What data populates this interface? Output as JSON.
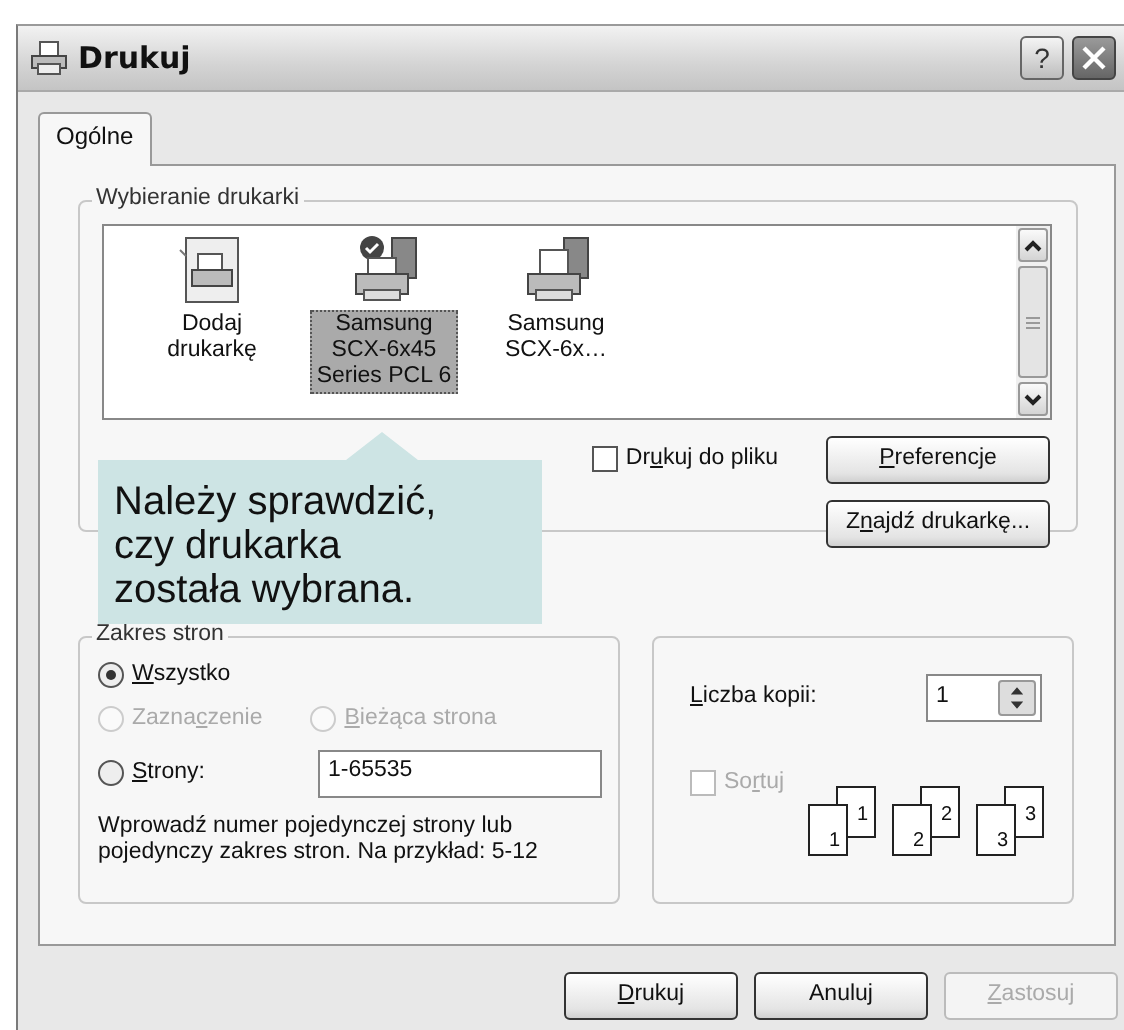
{
  "window": {
    "title": "Drukuj",
    "help": "?"
  },
  "tabs": [
    {
      "label": "Ogólne",
      "selected": true
    }
  ],
  "printer_selection": {
    "title": "Wybieranie drukarki",
    "printers": [
      {
        "lines": [
          "Dodaj",
          "drukarkę"
        ],
        "kind": "add",
        "selected": false
      },
      {
        "lines": [
          "Samsung",
          "SCX-6x45",
          "Series PCL 6"
        ],
        "kind": "default",
        "selected": true
      },
      {
        "lines": [
          "Samsung",
          "SCX-6x…"
        ],
        "kind": "printer",
        "selected": false
      }
    ],
    "print_to_file": {
      "label": [
        {
          "text": "Dr",
          "underline": false
        },
        {
          "text": "u",
          "underline": true
        },
        {
          "text": "kuj do pliku",
          "underline": false
        }
      ],
      "checked": false
    },
    "buttons": [
      {
        "label": [
          {
            "text": "P",
            "underline": true
          },
          {
            "text": "referencje",
            "underline": false
          }
        ]
      },
      {
        "label": [
          {
            "text": "Z",
            "underline": false
          },
          {
            "text": "n",
            "underline": true
          },
          {
            "text": "ajdź drukarkę...",
            "underline": false
          }
        ]
      }
    ]
  },
  "callout": {
    "lines": [
      "Należy sprawdzić,",
      "czy drukarka",
      "została wybrana."
    ]
  },
  "page_range": {
    "title": "Zakres stron",
    "options": [
      {
        "label": [
          {
            "text": "W",
            "underline": true
          },
          {
            "text": "szystko",
            "underline": false
          }
        ],
        "selected": true,
        "disabled": false
      },
      {
        "label": [
          {
            "text": "Zazna",
            "underline": false
          },
          {
            "text": "c",
            "underline": true
          },
          {
            "text": "zenie",
            "underline": false
          }
        ],
        "selected": false,
        "disabled": true
      },
      {
        "label": [
          {
            "text": "B",
            "underline": true
          },
          {
            "text": "ieżąca strona",
            "underline": false
          }
        ],
        "selected": false,
        "disabled": true
      },
      {
        "label": [
          {
            "text": "S",
            "underline": true
          },
          {
            "text": "trony:",
            "underline": false
          }
        ],
        "selected": false,
        "disabled": false
      }
    ],
    "pages_value": "1-65535",
    "hint": "Wprowadź numer pojedynczej strony lub pojedynczy zakres stron. Na przykład: 5-12"
  },
  "copies": {
    "label": [
      {
        "text": "L",
        "underline": true
      },
      {
        "text": "iczba kopii:",
        "underline": false
      }
    ],
    "value": "1",
    "collate": {
      "label": [
        {
          "text": "So",
          "underline": false
        },
        {
          "text": "r",
          "underline": true
        },
        {
          "text": "tuj",
          "underline": false
        }
      ],
      "checked": false,
      "disabled": true
    },
    "collate_pages": [
      {
        "back": "1",
        "front": "1"
      },
      {
        "back": "2",
        "front": "2"
      },
      {
        "back": "3",
        "front": "3"
      }
    ]
  },
  "footer_buttons": [
    {
      "label": [
        {
          "text": "D",
          "underline": true
        },
        {
          "text": "rukuj",
          "underline": false
        }
      ],
      "disabled": false
    },
    {
      "label": [
        {
          "text": "Anuluj",
          "underline": false
        }
      ],
      "disabled": false
    },
    {
      "label": [
        {
          "text": "Z",
          "underline": true
        },
        {
          "text": "astosuj",
          "underline": false
        }
      ],
      "disabled": true
    }
  ]
}
